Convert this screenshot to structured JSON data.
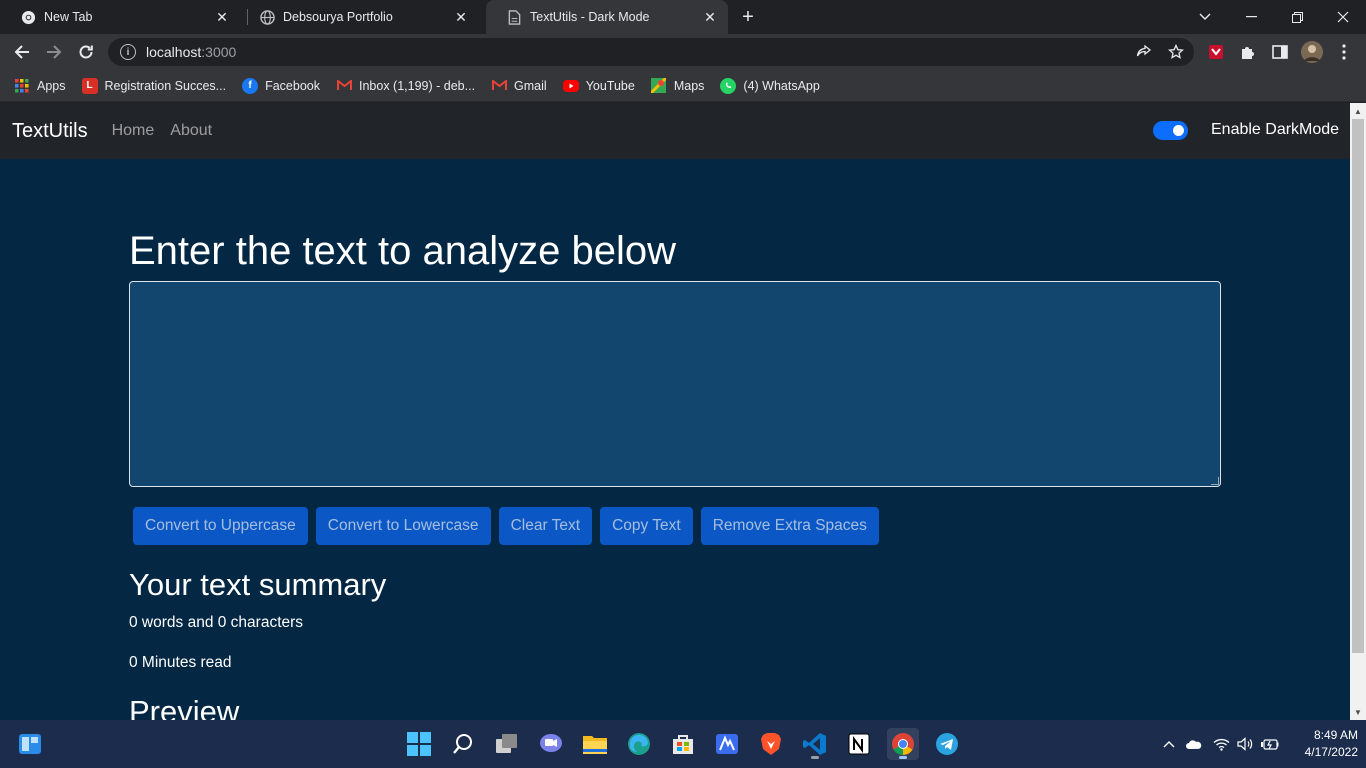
{
  "browser": {
    "tabs": [
      {
        "label": "New Tab",
        "icon": "chrome-icon"
      },
      {
        "label": "Debsourya Portfolio",
        "icon": "globe-icon"
      },
      {
        "label": "TextUtils - Dark Mode",
        "icon": "document-icon",
        "active": true
      }
    ],
    "url_host": "localhost",
    "url_port": ":3000",
    "bookmarks": [
      {
        "label": "Apps",
        "icon": "apps-grid-icon"
      },
      {
        "label": "Registration Succes...",
        "icon": "registration-icon",
        "icon_text": "L",
        "color": "#d93025"
      },
      {
        "label": "Facebook",
        "icon": "facebook-icon",
        "color": "#1877f2"
      },
      {
        "label": "Inbox (1,199) - deb...",
        "icon": "gmail-icon"
      },
      {
        "label": "Gmail",
        "icon": "gmail-icon"
      },
      {
        "label": "YouTube",
        "icon": "youtube-icon",
        "color": "#ff0000"
      },
      {
        "label": "Maps",
        "icon": "maps-icon"
      },
      {
        "label": "(4) WhatsApp",
        "icon": "whatsapp-icon",
        "color": "#25d366"
      }
    ]
  },
  "navbar": {
    "brand": "TextUtils",
    "links": [
      "Home",
      "About"
    ],
    "darkmode_label": "Enable DarkMode",
    "darkmode_on": true
  },
  "main": {
    "heading": "Enter the text to analyze below",
    "textarea_value": "",
    "buttons": [
      "Convert to Uppercase",
      "Convert to Lowercase",
      "Clear Text",
      "Copy Text",
      "Remove Extra Spaces"
    ],
    "summary_title": "Your text summary",
    "summary_words": "0 words and 0 characters",
    "summary_read": "0 Minutes read",
    "preview_title": "Preview"
  },
  "colors": {
    "page_bg": "#042743",
    "navbar_bg": "#212529",
    "textarea_bg": "#13466e",
    "button_bg": "#0d6efd"
  },
  "taskbar": {
    "apps": [
      "start-icon",
      "search-icon",
      "task-view-icon",
      "chat-icon",
      "file-explorer-icon",
      "edge-icon",
      "store-icon",
      "photos-icon",
      "brave-icon",
      "vscode-icon",
      "notion-icon",
      "chrome-icon",
      "telegram-icon"
    ],
    "time": "8:49 AM",
    "date": "4/17/2022"
  }
}
